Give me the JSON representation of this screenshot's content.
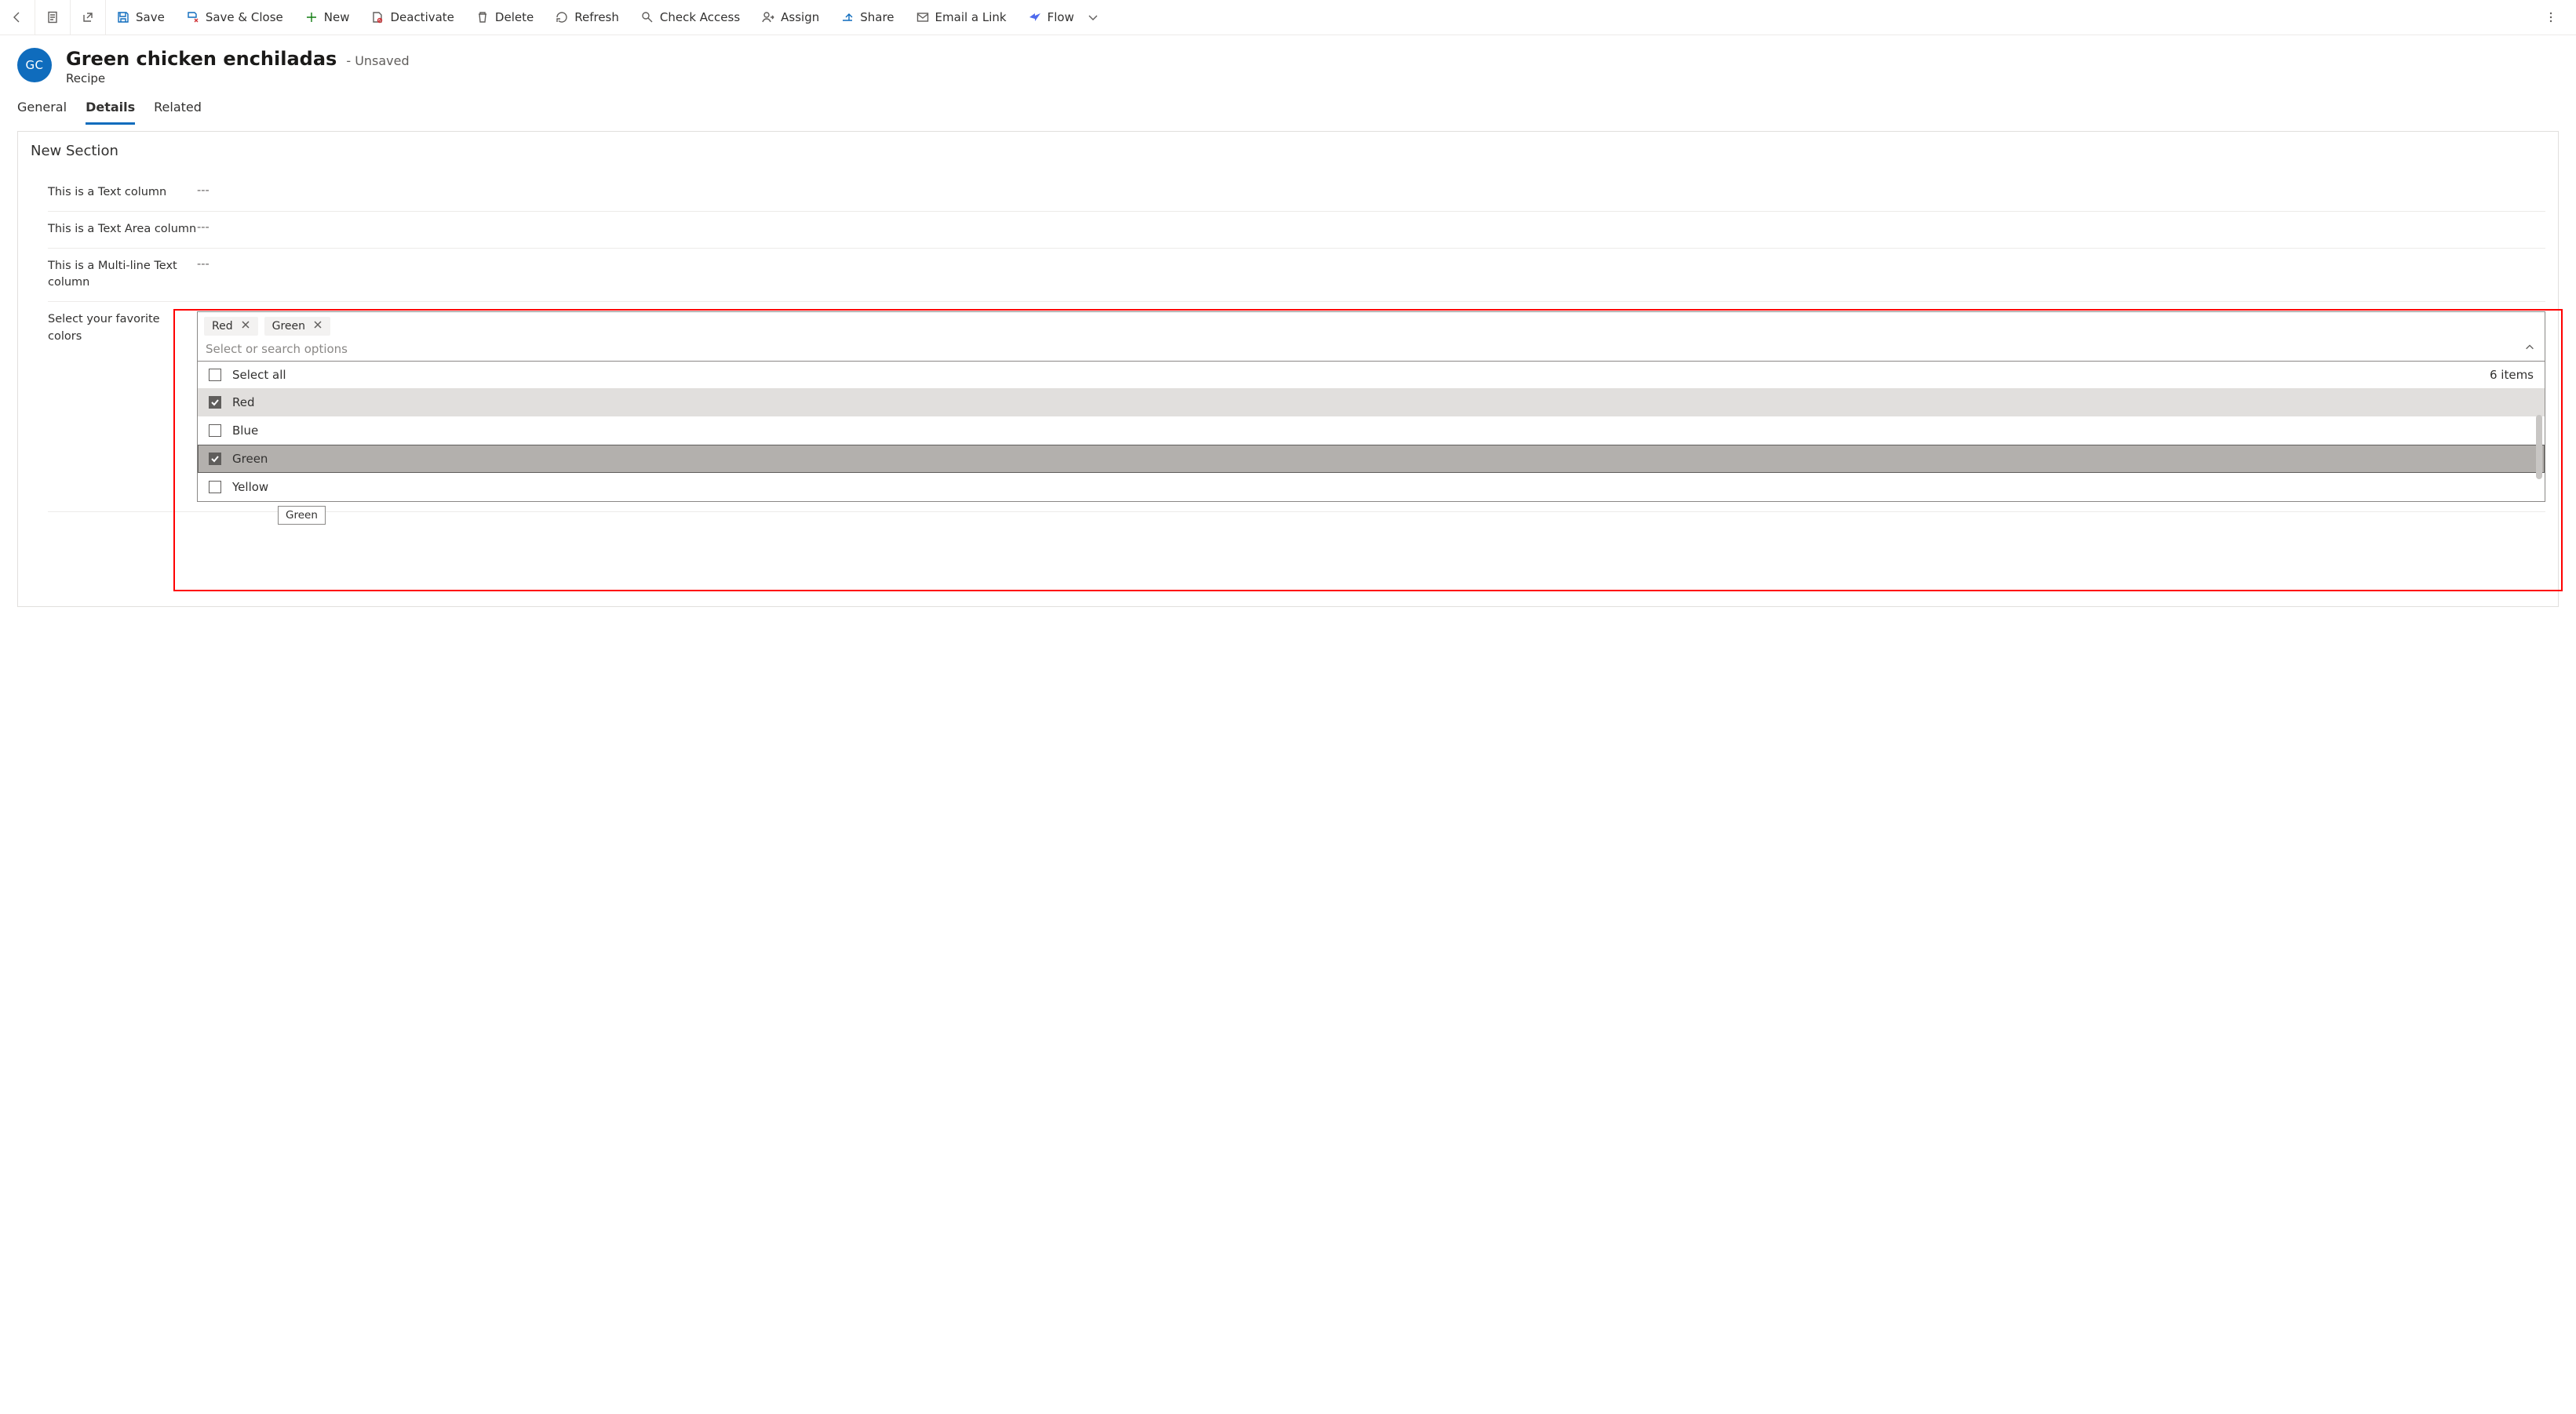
{
  "toolbar": {
    "back": "Back",
    "save": "Save",
    "save_close": "Save & Close",
    "new": "New",
    "deactivate": "Deactivate",
    "delete": "Delete",
    "refresh": "Refresh",
    "check_access": "Check Access",
    "assign": "Assign",
    "share": "Share",
    "email_link": "Email a Link",
    "flow": "Flow"
  },
  "header": {
    "avatar": "GC",
    "title": "Green chicken enchiladas",
    "status": "- Unsaved",
    "entity": "Recipe"
  },
  "tabs": {
    "general": "General",
    "details": "Details",
    "related": "Related"
  },
  "section": {
    "title": "New Section",
    "text_col_label": "This is a Text column",
    "text_col_value": "---",
    "textarea_label": "This is a Text Area column",
    "textarea_value": "---",
    "multiline_label": "This is a Multi-line Text column",
    "multiline_value": "---",
    "colors_label": "Select your favorite colors"
  },
  "multiselect": {
    "chip1": "Red",
    "chip2": "Green",
    "placeholder": "Select or search options",
    "select_all": "Select all",
    "count": "6 items",
    "opt_red": "Red",
    "opt_blue": "Blue",
    "opt_green": "Green",
    "opt_yellow": "Yellow",
    "tooltip": "Green"
  }
}
